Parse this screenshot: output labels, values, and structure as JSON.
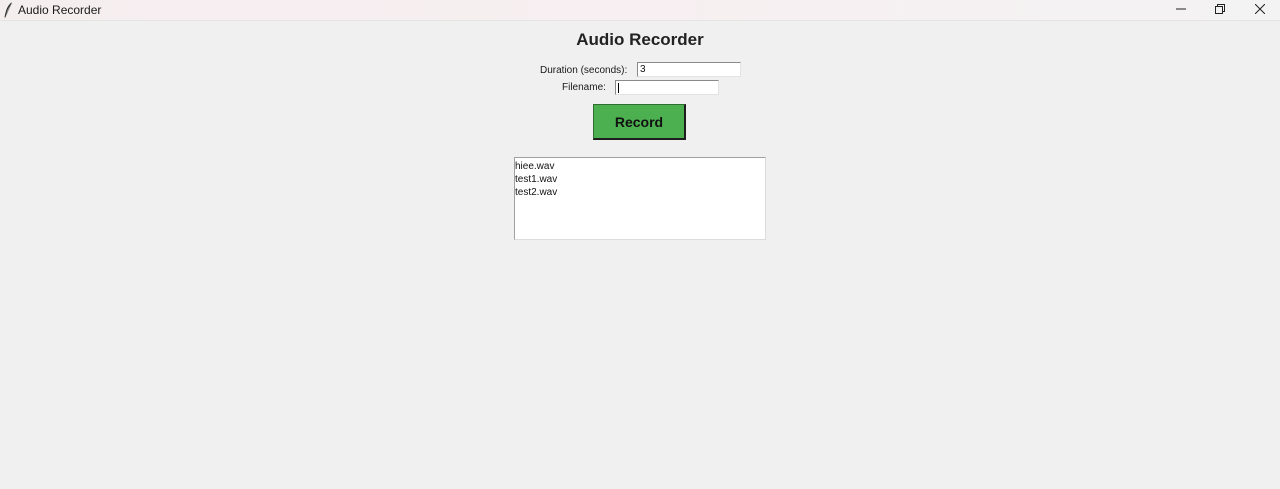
{
  "window": {
    "title": "Audio Recorder"
  },
  "main": {
    "heading": "Audio Recorder",
    "duration_label": "Duration (seconds):",
    "duration_value": "3",
    "filename_label": "Filename:",
    "filename_value": "",
    "record_label": "Record"
  },
  "files": [
    {
      "name": "hiee.wav"
    },
    {
      "name": "test1.wav"
    },
    {
      "name": "test2.wav"
    }
  ],
  "colors": {
    "record_button": "#4caf50",
    "background": "#f0f0f0"
  },
  "icons": {
    "app": "feather-icon",
    "minimize": "minimize-icon",
    "maximize": "restore-icon",
    "close": "close-icon"
  }
}
